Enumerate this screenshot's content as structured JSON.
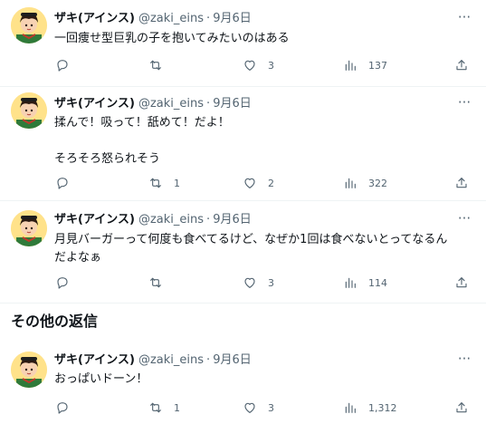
{
  "tweets": [
    {
      "name": "ザキ(アインス)",
      "handle": "@zaki_eins",
      "date": "9月6日",
      "text": "一回痩せ型巨乳の子を抱いてみたいのはある",
      "replies": "",
      "retweets": "",
      "likes": "3",
      "views": "137"
    },
    {
      "name": "ザキ(アインス)",
      "handle": "@zaki_eins",
      "date": "9月6日",
      "text": "揉んで！吸って！舐めて！だよ！\n\nそろそろ怒られそう",
      "replies": "",
      "retweets": "1",
      "likes": "2",
      "views": "322"
    },
    {
      "name": "ザキ(アインス)",
      "handle": "@zaki_eins",
      "date": "9月6日",
      "text": "月見バーガーって何度も食べてるけど、なぜか1回は食べないとってなるん\nだよなぁ",
      "replies": "",
      "retweets": "",
      "likes": "3",
      "views": "114"
    },
    {
      "name": "ザキ(アインス)",
      "handle": "@zaki_eins",
      "date": "9月6日",
      "text": "おっぱいドーン！",
      "replies": "",
      "retweets": "1",
      "likes": "3",
      "views": "1,312"
    }
  ],
  "section_title": "その他の返信",
  "more_glyph": "···",
  "separator": "·",
  "icons": [
    "reply-icon",
    "retweet-icon",
    "like-icon",
    "views-icon",
    "share-icon",
    "more-icon"
  ],
  "colors": {
    "text": "#0f1419",
    "secondary": "#536471",
    "border": "#eff3f4"
  }
}
